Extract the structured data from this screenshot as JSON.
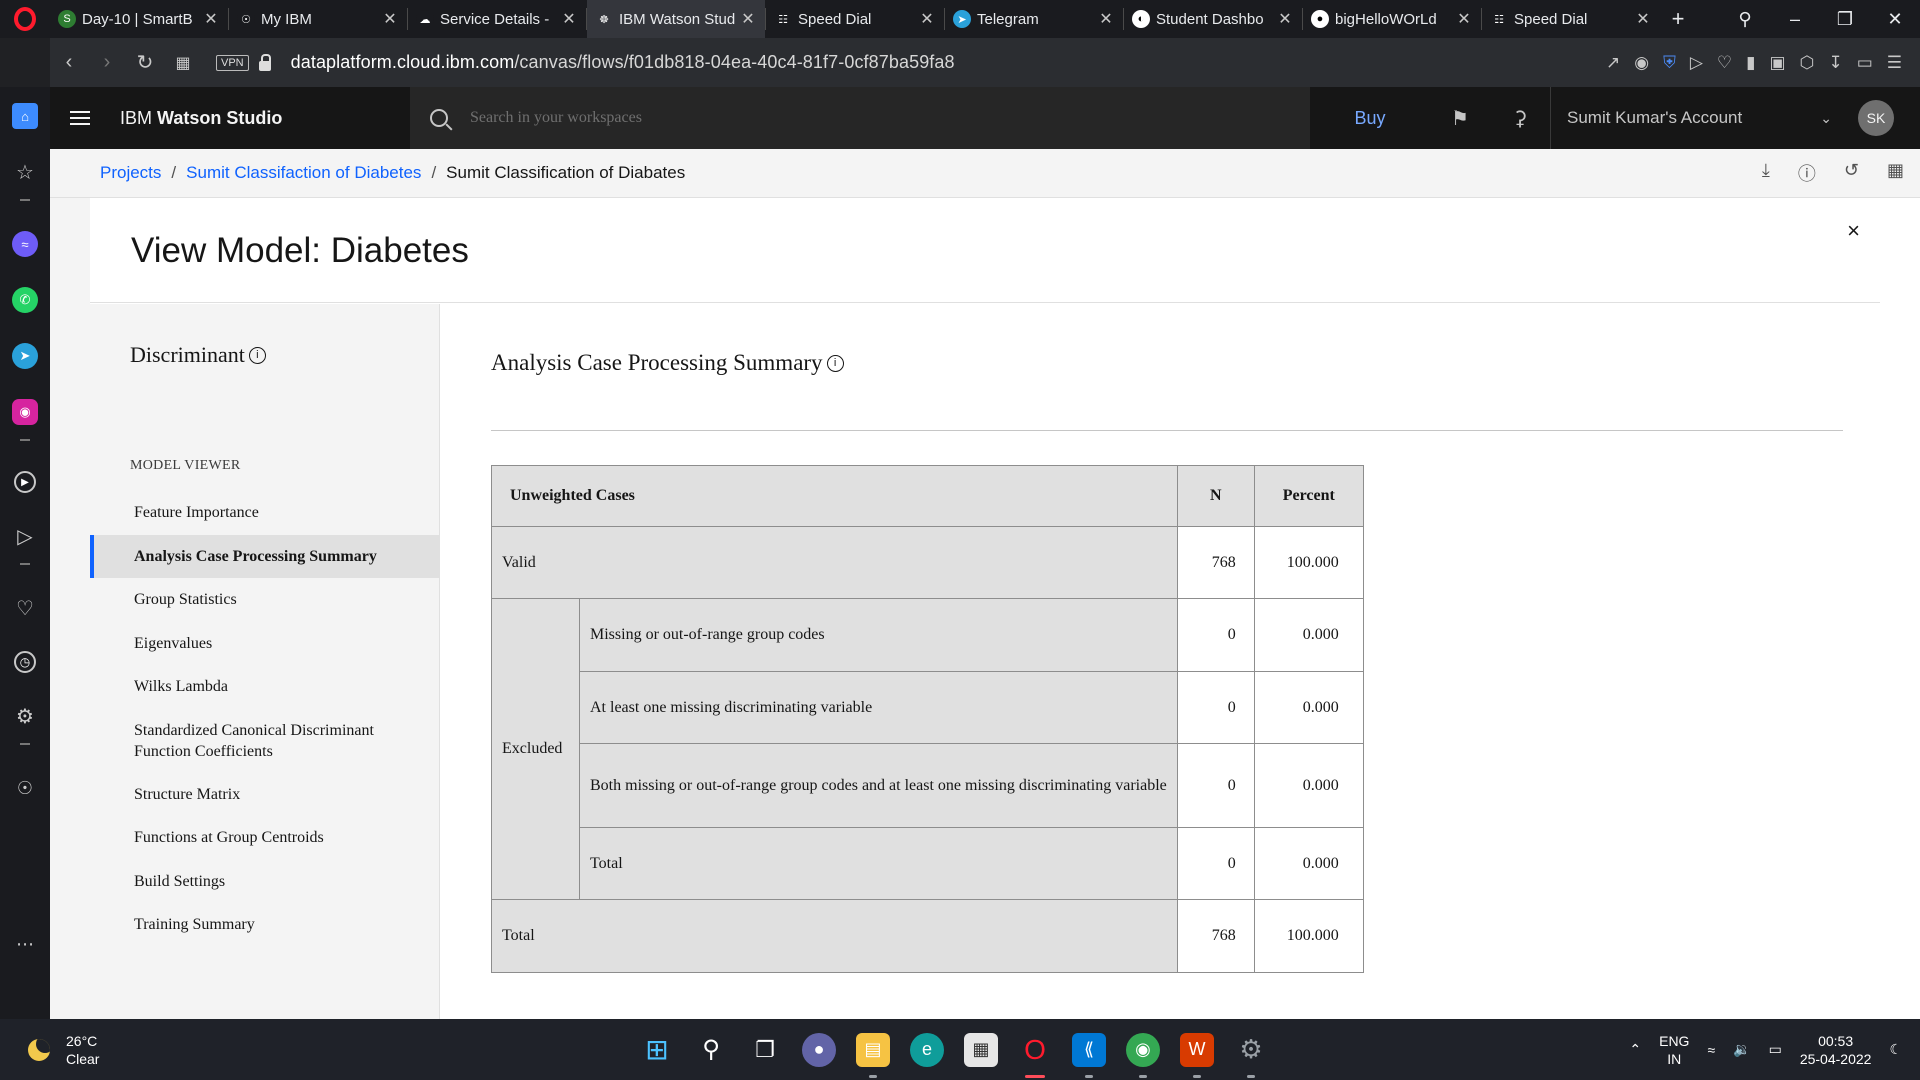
{
  "browser": {
    "tabs": [
      {
        "title": "Day-10 | SmartB",
        "icon_color": "#2e7d32",
        "icon": "S"
      },
      {
        "title": "My IBM",
        "icon_color": "#1a1b1f",
        "icon": "☉"
      },
      {
        "title": "Service Details -",
        "icon_color": "#1a1b1f",
        "icon": "☁"
      },
      {
        "title": "IBM Watson Stud",
        "icon_color": "#34363c",
        "icon": "☸"
      },
      {
        "title": "Speed Dial",
        "icon_color": "#1a1b1f",
        "icon": "☷"
      },
      {
        "title": "Telegram",
        "icon_color": "#2aa1da",
        "icon": "➤"
      },
      {
        "title": "Student Dashbo",
        "icon_color": "#ffffff",
        "icon": "◐"
      },
      {
        "title": "bigHelloWOrLd",
        "icon_color": "#ffffff",
        "icon": "●"
      },
      {
        "title": "Speed Dial",
        "icon_color": "#1a1b1f",
        "icon": "☷"
      }
    ],
    "active_tab_index": 3,
    "new_tab_label": "+",
    "url_domain": "dataplatform.cloud.ibm.com",
    "url_path": "/canvas/flows/f01db818-04ea-40c4-81f7-0cf87ba59fa8",
    "vpn_label": "VPN"
  },
  "ws": {
    "product_prefix": "IBM ",
    "product_name": "Watson Studio",
    "search_placeholder": "Search in your workspaces",
    "buy_label": "Buy",
    "account_label": "Sumit Kumar's Account",
    "avatar_initials": "SK"
  },
  "breadcrumb": {
    "items": [
      "Projects",
      "Sumit Classifaction of Diabetes"
    ],
    "current": "Sumit Classification of Diabates",
    "separator": "/"
  },
  "modal": {
    "title": "View Model: Diabetes",
    "close_label": "×"
  },
  "model_viewer": {
    "heading": "Discriminant",
    "section_label": "MODEL VIEWER",
    "items": [
      "Feature Importance",
      "Analysis Case Processing Summary",
      "Group Statistics",
      "Eigenvalues",
      "Wilks Lambda",
      "Standardized Canonical Discriminant Function Coefficients",
      "Structure Matrix",
      "Functions at Group Centroids",
      "Build Settings",
      "Training Summary"
    ],
    "selected_index": 1
  },
  "summary": {
    "title": "Analysis Case Processing Summary",
    "headers": [
      "Unweighted Cases",
      "N",
      "Percent"
    ],
    "valid": {
      "label": "Valid",
      "n": "768",
      "percent": "100.000"
    },
    "excluded_label": "Excluded",
    "excluded_rows": [
      {
        "label": "Missing or out-of-range group codes",
        "n": "0",
        "percent": "0.000"
      },
      {
        "label": "At least one missing discriminating variable",
        "n": "0",
        "percent": "0.000"
      },
      {
        "label": "Both missing or out-of-range group codes and at least one missing discriminating variable",
        "n": "0",
        "percent": "0.000"
      },
      {
        "label": "Total",
        "n": "0",
        "percent": "0.000"
      }
    ],
    "total": {
      "label": "Total",
      "n": "768",
      "percent": "100.000"
    }
  },
  "taskbar": {
    "temperature": "26°C",
    "weather": "Clear",
    "lang_top": "ENG",
    "lang_bottom": "IN",
    "time": "00:53",
    "date": "25-04-2022"
  },
  "colors": {
    "ibm_blue": "#0f62fe",
    "header_bg": "#161616",
    "selected_bg": "#e0e0e0",
    "opera_red": "#ff1b2d"
  }
}
